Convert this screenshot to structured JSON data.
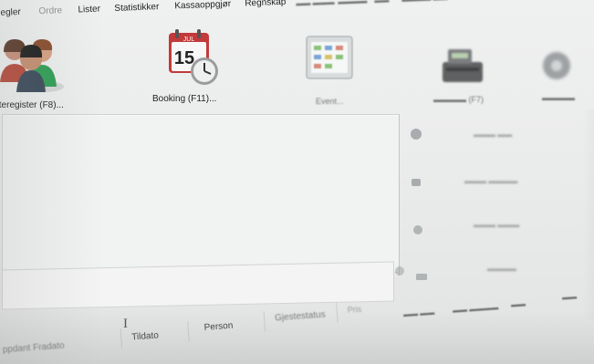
{
  "menu": {
    "items": [
      {
        "label": "egler",
        "faded": false
      },
      {
        "label": "Ordre",
        "faded": true
      },
      {
        "label": "Lister",
        "faded": false
      },
      {
        "label": "Statistikker",
        "faded": false
      },
      {
        "label": "Kassaoppgjør",
        "faded": false
      },
      {
        "label": "Regnskap",
        "faded": false
      }
    ]
  },
  "toolbar": {
    "guest_register_label": "tteregister (F8)...",
    "booking_label": "Booking (F11)...",
    "booking_calendar_month": "JUL",
    "booking_calendar_day": "15",
    "event_label": "Event..."
  },
  "list_columns": {
    "col0": "ppdant  Fradato",
    "col1": "Tildato",
    "col2": "Person",
    "col3": "Gjestestatus",
    "col4": "Pris"
  },
  "cursor": "I",
  "colors": {
    "background": "#ebecec",
    "panel": "#f1f2f2",
    "text": "#1f1f1f"
  }
}
